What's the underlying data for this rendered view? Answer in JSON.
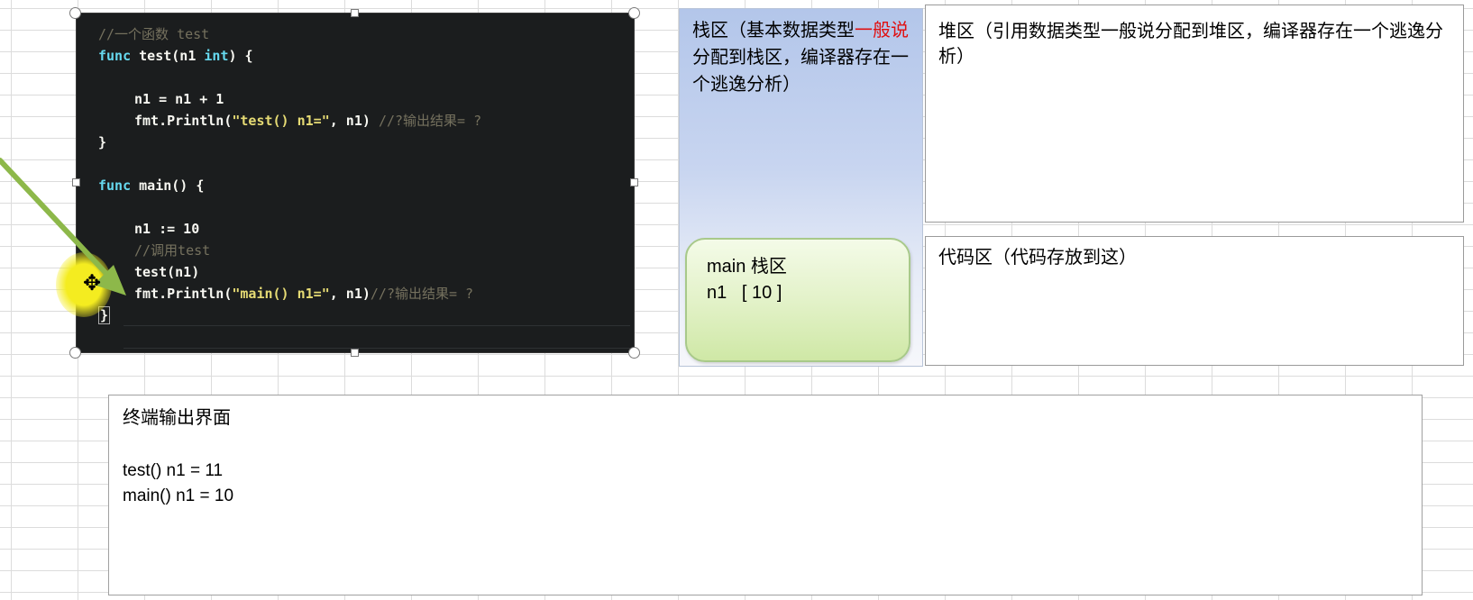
{
  "code_editor": {
    "lines": [
      {
        "type": "comment",
        "text": "//一个函数 test"
      },
      {
        "type": "func_sig",
        "kw": "func",
        "rest_a": " test(n1 ",
        "kw2": "int",
        "rest_b": ") {"
      },
      {
        "type": "stmt",
        "text": "n1 = n1 + 1"
      },
      {
        "type": "println",
        "pre": "fmt.Println(",
        "str": "\"test() n1=\"",
        "post": ", n1) ",
        "cmt": "//?输出结果= ?"
      },
      {
        "type": "plain",
        "text": "}"
      },
      {
        "type": "func_main",
        "kw": "func",
        "rest": " main() {"
      },
      {
        "type": "stmt",
        "text": "n1 := 10"
      },
      {
        "type": "comment",
        "text": "//调用test"
      },
      {
        "type": "stmt",
        "text": "test(n1)"
      },
      {
        "type": "println",
        "pre": "fmt.Println(",
        "str": "\"main() n1=\"",
        "post": ", n1)",
        "cmt": "//?输出结果= ?"
      },
      {
        "type": "plain",
        "text": "}"
      }
    ]
  },
  "stack_area": {
    "title_part1": "栈区（基本数据类型",
    "title_red": "一般说",
    "title_part2": "分配到栈区，编译器存在一个逃逸分析）",
    "main_frame": {
      "line1": "main 栈区",
      "line2": "n1   [ 10 ]"
    }
  },
  "heap_area": {
    "text": "堆区（引用数据类型一般说分配到堆区，编译器存在一个逃逸分析）"
  },
  "code_area": {
    "text": "代码区（代码存放到这）"
  },
  "terminal": {
    "title": "终端输出界面",
    "lines": [
      "test() n1 = 11",
      "main() n1 = 10"
    ]
  },
  "colors": {
    "editor_bg": "#1b1d1e",
    "keyword": "#66d9ef",
    "string": "#e6db74",
    "comment": "#75715e",
    "highlight_red": "#e01010",
    "arrow_green": "#8db84a",
    "cursor_spot": "#f4ec20"
  }
}
